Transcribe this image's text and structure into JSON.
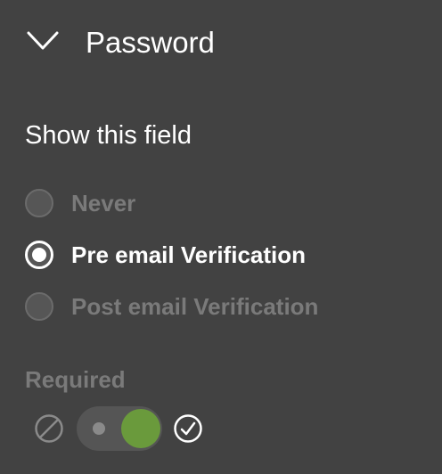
{
  "section": {
    "title": "Password",
    "expanded": true,
    "toggle_icon": "chevron-down-icon"
  },
  "show_field": {
    "label": "Show this field",
    "options": [
      {
        "label": "Never",
        "selected": false
      },
      {
        "label": "Pre email Verification",
        "selected": true
      },
      {
        "label": "Post email Verification",
        "selected": false
      }
    ]
  },
  "required": {
    "label": "Required",
    "value": true,
    "off_icon": "disabled-circle-icon",
    "on_icon": "check-circle-icon"
  },
  "colors": {
    "background": "#424242",
    "text": "#ffffff",
    "dim_text": "#7a7a7a",
    "toggle_on": "#6a9a3c"
  }
}
